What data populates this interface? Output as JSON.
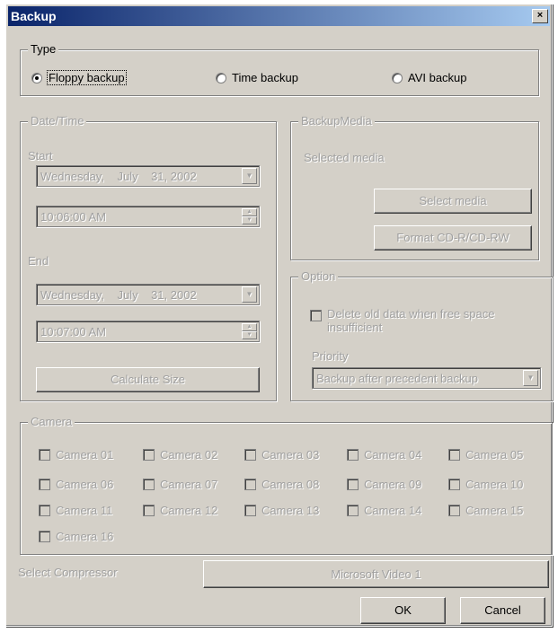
{
  "window": {
    "title": "Backup",
    "close_glyph": "×"
  },
  "type_group": {
    "label": "Type",
    "options": [
      {
        "label": "Floppy backup",
        "selected": true
      },
      {
        "label": "Time backup",
        "selected": false
      },
      {
        "label": "AVI backup",
        "selected": false
      }
    ]
  },
  "datetime": {
    "label": "Date/Time",
    "start_label": "Start",
    "start_date": "Wednesday,    July    31, 2002",
    "start_time": "10:06:00 AM",
    "end_label": "End",
    "end_date": "Wednesday,    July    31, 2002",
    "end_time": "10:07:00 AM",
    "calc_button": "Calculate Size"
  },
  "backup_media": {
    "label": "BackupMedia",
    "selected_media": "Selected media",
    "select_button": "Select media",
    "format_button": "Format CD-R/CD-RW"
  },
  "option": {
    "label": "Option",
    "delete_old": "Delete old data when free space insufficient",
    "priority_label": "Priority",
    "priority_value": "Backup after precedent backup"
  },
  "camera": {
    "label": "Camera",
    "items": [
      "Camera 01",
      "Camera 02",
      "Camera 03",
      "Camera 04",
      "Camera 05",
      "Camera 06",
      "Camera 07",
      "Camera 08",
      "Camera 09",
      "Camera 10",
      "Camera 11",
      "Camera 12",
      "Camera 13",
      "Camera 14",
      "Camera 15",
      "Camera 16"
    ]
  },
  "compressor": {
    "label": "Select Compressor",
    "value": "Microsoft Video 1"
  },
  "buttons": {
    "ok": "OK",
    "cancel": "Cancel"
  }
}
